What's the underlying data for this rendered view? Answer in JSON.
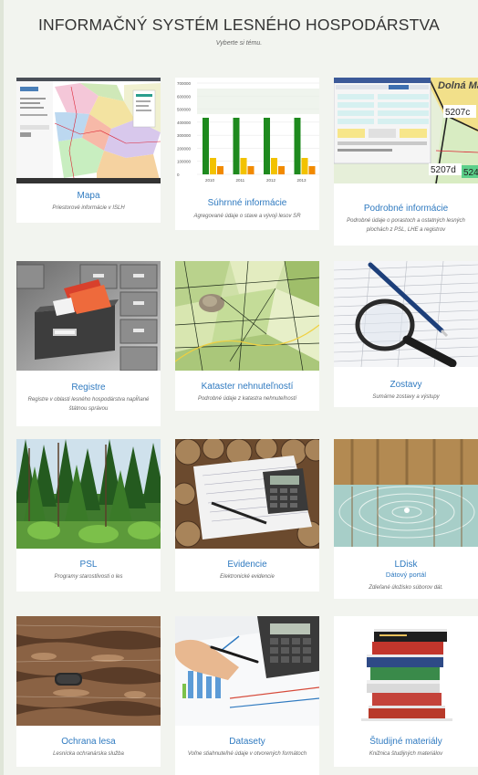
{
  "header": {
    "title": "INFORMAČNÝ SYSTÉM LESNÉHO HOSPODÁRSTVA",
    "subtitle": "Vyberte si tému."
  },
  "tiles": [
    {
      "title": "Mapa",
      "description": "Priestorové informácie v ISLH"
    },
    {
      "title": "Súhrnné informácie",
      "description": "Agregované údaje o stave a vývoji lesov SR"
    },
    {
      "title": "Podrobné informácie",
      "description": "Podrobné údaje o porastoch a ostatných lesných plochách z PSL, LHE a registrov"
    },
    {
      "title": "Registre",
      "description": "Registre v oblasti lesného hospodárstva napĺňané štátnou správou"
    },
    {
      "title": "Kataster nehnuteľností",
      "description": "Podrobné údaje z katastra nehnuteľností"
    },
    {
      "title": "Zostavy",
      "description": "Sumárne zostavy a výstupy"
    },
    {
      "title": "PSL",
      "description": "Programy starostlivosti o les"
    },
    {
      "title": "Evidencie",
      "description": "Elektronické evidencie"
    },
    {
      "title": "LDisk",
      "subtitle": "Dátový portál",
      "description": "Zdieľané úložisko súborov dát."
    },
    {
      "title": "Ochrana lesa",
      "description": "Lesnícka ochranárska služba"
    },
    {
      "title": "Datasety",
      "description": "Voľne stiahnuteľné údaje v otvorených formátoch"
    },
    {
      "title": "Študijné materiály",
      "description": "Knižnica študijných materiálov"
    }
  ],
  "thumbs": {
    "chart": {
      "yticks": [
        "700000",
        "600000",
        "500000",
        "400000",
        "300000",
        "200000",
        "100000",
        "0"
      ],
      "years": [
        "2010",
        "2011",
        "2012",
        "2013"
      ]
    },
    "detail": {
      "labels": [
        "Dolná Ma",
        "5207c",
        "5207d",
        "524"
      ]
    }
  }
}
